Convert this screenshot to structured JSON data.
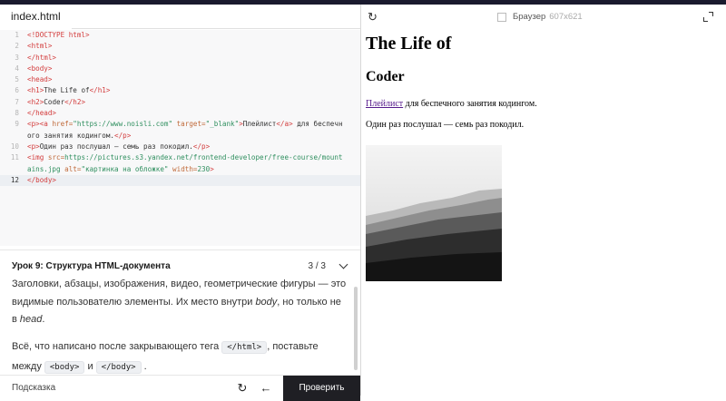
{
  "editor": {
    "tab": "index.html",
    "lines": [
      {
        "n": "1",
        "html": "<span class=\"tag\">&lt;!DOCTYPE html&gt;</span>"
      },
      {
        "n": "2",
        "html": "<span class=\"tag\">&lt;html&gt;</span>"
      },
      {
        "n": "3",
        "html": "<span class=\"tag\">&lt;/html&gt;</span>"
      },
      {
        "n": "4",
        "html": "<span class=\"tag\">&lt;body&gt;</span>"
      },
      {
        "n": "5",
        "html": "<span class=\"tag\">&lt;head&gt;</span>"
      },
      {
        "n": "6",
        "html": "<span class=\"tag\">&lt;h1&gt;</span><span class=\"txt\">The Life of</span><span class=\"tag\">&lt;/h1&gt;</span>"
      },
      {
        "n": "7",
        "html": "<span class=\"tag\">&lt;h2&gt;</span><span class=\"txt\">Coder</span><span class=\"tag\">&lt;/h2&gt;</span>"
      },
      {
        "n": "8",
        "html": "<span class=\"tag\">&lt;/head&gt;</span>"
      },
      {
        "n": "9",
        "html": "<span class=\"tag\">&lt;p&gt;&lt;a</span> <span class=\"attr\">href=</span><span class=\"str\">\"https://www.noisli.com\"</span> <span class=\"attr\">target=</span><span class=\"str\">\"_blank\"</span><span class=\"tag\">&gt;</span><span class=\"txt\">Плейлист</span><span class=\"tag\">&lt;/a&gt;</span> <span class=\"txt\">для беспечн</span>"
      },
      {
        "n": "",
        "html": "<span class=\"txt\">ого занятия кодингом.</span><span class=\"tag\">&lt;/p&gt;</span>"
      },
      {
        "n": "10",
        "html": "<span class=\"tag\">&lt;p&gt;</span><span class=\"txt\">Один раз послушал — семь раз покодил.</span><span class=\"tag\">&lt;/p&gt;</span>"
      },
      {
        "n": "11",
        "html": "<span class=\"tag\">&lt;img</span> <span class=\"attr\">src=</span><span class=\"str\">https://pictures.s3.yandex.net/frontend-developer/free-course/mount</span>"
      },
      {
        "n": "",
        "html": "<span class=\"str\">ains.jpg</span> <span class=\"attr\">alt=</span><span class=\"str\">\"картинка на обложке\"</span> <span class=\"attr\">width=</span><span class=\"str\">230</span><span class=\"tag\">&gt;</span>"
      },
      {
        "n": "12",
        "html": "<span class=\"tag\">&lt;/body&gt;</span>",
        "active": true
      }
    ]
  },
  "lesson": {
    "title": "Урок 9: Структура HTML-документа",
    "progress": "3 / 3",
    "p1_a": "Заголовки, абзацы, изображения, видео, геометрические фигуры — это видимые пользователю элементы. Их место внутри ",
    "p1_body": "body",
    "p1_b": ", но только не в ",
    "p1_head": "head",
    "p1_c": ".",
    "p2_a": "Всё, что написано после закрывающего тега ",
    "p2_code1": "</html>",
    "p2_b": ", поставьте между ",
    "p2_code2": "<body>",
    "p2_c": " и ",
    "p2_code3": "</body>",
    "p2_d": " ."
  },
  "footer": {
    "hint": "Подсказка",
    "reset_icon": "↻",
    "back_icon": "←",
    "check": "Проверить"
  },
  "browser": {
    "reload_icon": "↻",
    "title": "Браузер",
    "size": "607x621",
    "h1": "The Life of",
    "h2": "Coder",
    "link": "Плейлист",
    "p1_rest": " для беспечного занятия кодингом.",
    "p2": "Один раз послушал — семь раз покодил.",
    "img_alt": "картинка на обложке"
  }
}
